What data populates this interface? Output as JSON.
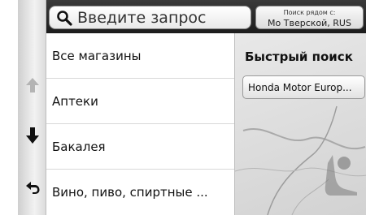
{
  "search": {
    "placeholder": "Введите запрос",
    "icon": "search-icon"
  },
  "near": {
    "caption": "Поиск рядом с:",
    "value": "Мо Тверской, RUS"
  },
  "nav": {
    "up_icon": "arrow-up-icon",
    "up_enabled": false,
    "down_icon": "arrow-down-icon",
    "back_icon": "back-icon"
  },
  "categories": {
    "items": [
      {
        "label": "Все магазины"
      },
      {
        "label": "Аптеки"
      },
      {
        "label": "Бакалея"
      },
      {
        "label": "Вино, пиво, спиртные ..."
      }
    ]
  },
  "quick_search": {
    "title": "Быстрый поиск",
    "result": "Honda Motor Europ..."
  },
  "colors": {
    "topbar": "#1c1c1c",
    "list_background": "#ffffff",
    "panel_background": "#d8d8d8"
  }
}
